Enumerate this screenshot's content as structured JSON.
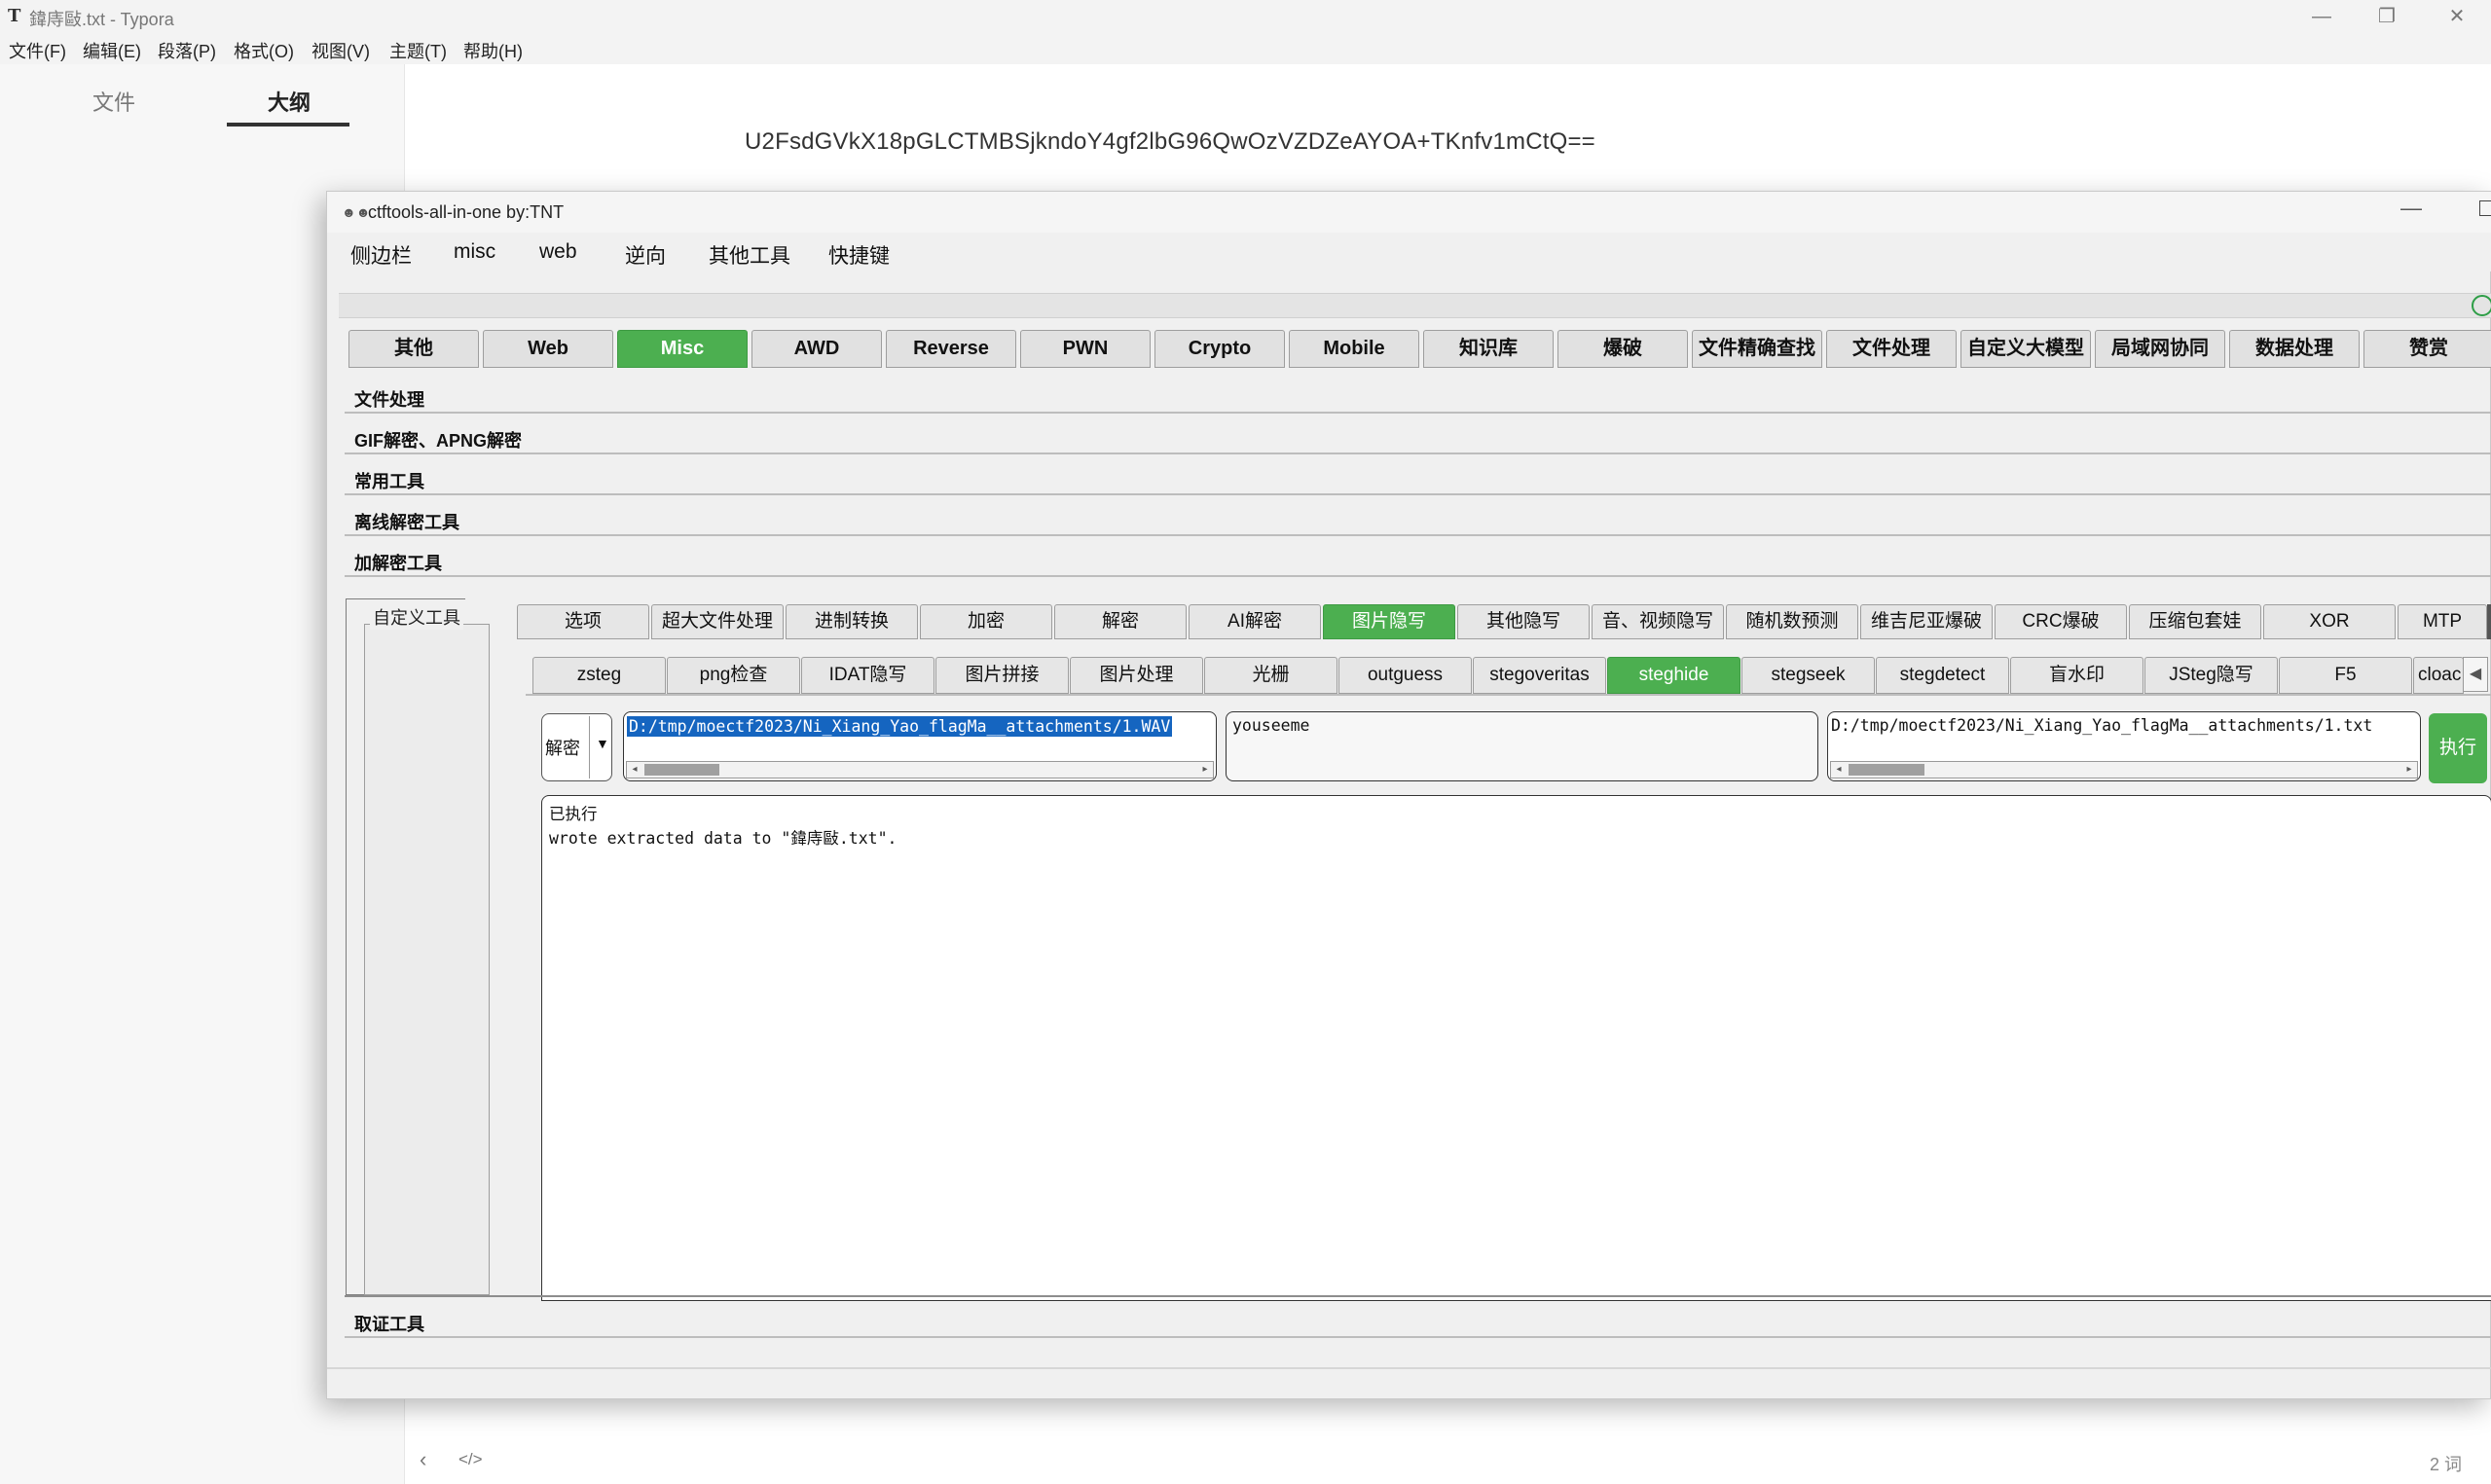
{
  "typora": {
    "app_icon": "T",
    "window_title": "鍏庤敺.txt - Typora",
    "window_controls": {
      "minimize": "—",
      "restore": "❐",
      "close": "✕"
    },
    "menu": [
      "文件(F)",
      "编辑(E)",
      "段落(P)",
      "格式(O)",
      "视图(V)",
      "主题(T)",
      "帮助(H)"
    ],
    "sidebar_tabs": [
      "文件",
      "大纲"
    ],
    "active_sidebar_tab": "大纲",
    "document_text": "U2FsdGVkX18pGLCTMBSjkndoY4gf2lbG96QwOzVZDZeAYOA+TKnfv1mCtQ==",
    "footer": {
      "back_icon": "‹",
      "code_icon": "</>",
      "word_count": "2 词"
    }
  },
  "ctftools": {
    "window_icon": "☻☻",
    "window_title": "ctftools-all-in-one   by:TNT",
    "minimize": "—",
    "menu": [
      "侧边栏",
      "misc",
      "web",
      "逆向",
      "其他工具",
      "快捷键"
    ],
    "main_tabs": [
      "其他",
      "Web",
      "Misc",
      "AWD",
      "Reverse",
      "PWN",
      "Crypto",
      "Mobile",
      "知识库",
      "爆破",
      "文件精确查找",
      "文件处理",
      "自定义大模型",
      "局域网协同",
      "数据处理",
      "赞赏"
    ],
    "active_main_tab": "Misc",
    "sections": [
      "文件处理",
      "GIF解密、APNG解密",
      "常用工具",
      "离线解密工具",
      "加解密工具"
    ],
    "side_title": "自定义工具",
    "sub_tabs": [
      "选项",
      "超大文件处理",
      "进制转换",
      "加密",
      "解密",
      "AI解密",
      "图片隐写",
      "其他隐写",
      "音、视频隐写",
      "随机数预测",
      "维吉尼亚爆破",
      "CRC爆破",
      "压缩包套娃",
      "XOR",
      "MTP"
    ],
    "active_sub_tab": "图片隐写",
    "tool_tabs": [
      "zsteg",
      "png检查",
      "IDAT隐写",
      "图片拼接",
      "图片处理",
      "光栅",
      "outguess",
      "stegoveritas",
      "steghide",
      "stegseek",
      "stegdetect",
      "盲水印",
      "JSteg隐写",
      "F5",
      "cloac"
    ],
    "active_tool_tab": "steghide",
    "tool_scroll_left": "◀",
    "mode_select": {
      "value": "解密",
      "arrow": "▼"
    },
    "input_path": "D:/tmp/moectf2023/Ni_Xiang_Yao_flagMa__attachments/1.WAV",
    "password": "youseeme",
    "output_path": "D:/tmp/moectf2023/Ni_Xiang_Yao_flagMa__attachments/1.txt",
    "run_button": "执行",
    "output_lines": [
      "已执行",
      "wrote extracted data to \"鍏庤敺.txt\"."
    ],
    "forensic_section": "取证工具",
    "scroll_arrows": {
      "left": "◂",
      "right": "▸"
    },
    "colors": {
      "accent_green": "#4caf50",
      "selection_blue": "#1565c0"
    }
  }
}
